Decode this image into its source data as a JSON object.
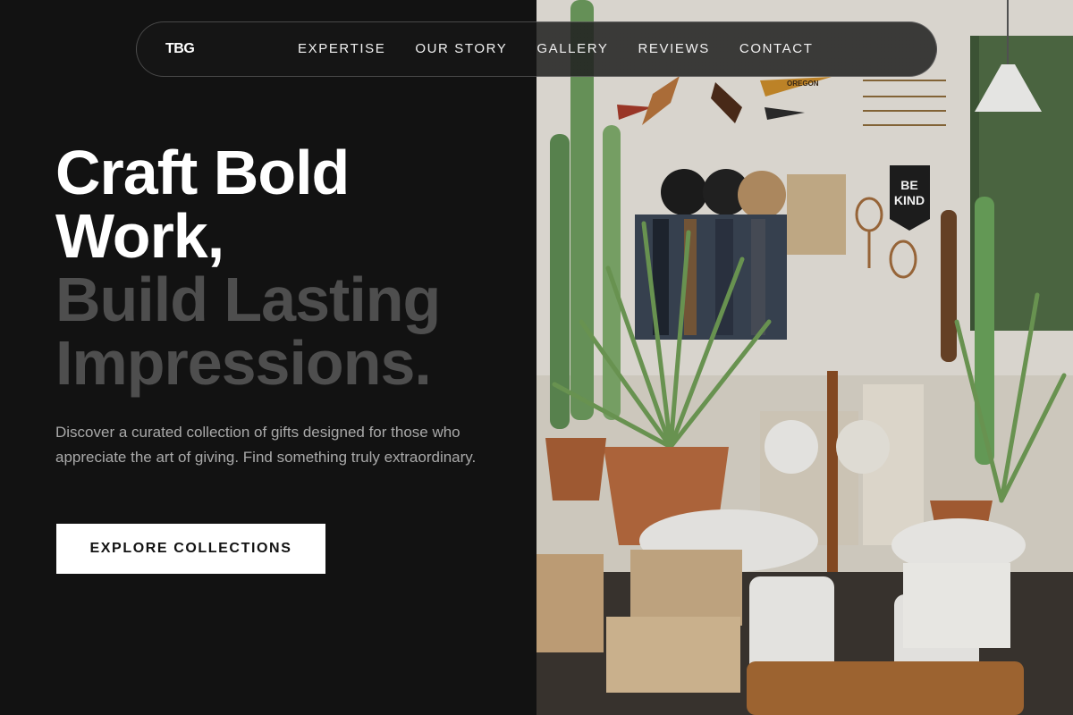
{
  "nav": {
    "logo": "TBG",
    "links": [
      {
        "label": "EXPERTISE"
      },
      {
        "label": "OUR STORY"
      },
      {
        "label": "GALLERY"
      },
      {
        "label": "REVIEWS"
      },
      {
        "label": "CONTACT"
      }
    ]
  },
  "hero": {
    "title_line1": "Craft Bold",
    "title_line2": "Work,",
    "title_line3": "Build Lasting",
    "title_line4": "Impressions.",
    "description": "Discover a curated collection of gifts designed for those who appreciate the art of giving. Find something truly extraordinary.",
    "cta_label": "EXPLORE COLLECTIONS"
  },
  "photo": {
    "banner_text_1": "BE",
    "banner_text_2": "KIND",
    "pennant_text": "OREGON"
  },
  "colors": {
    "background": "#121212",
    "title_white": "#ffffff",
    "title_grey": "#4e4e4e",
    "text_muted": "#a9a9a9",
    "button_bg": "#ffffff"
  }
}
